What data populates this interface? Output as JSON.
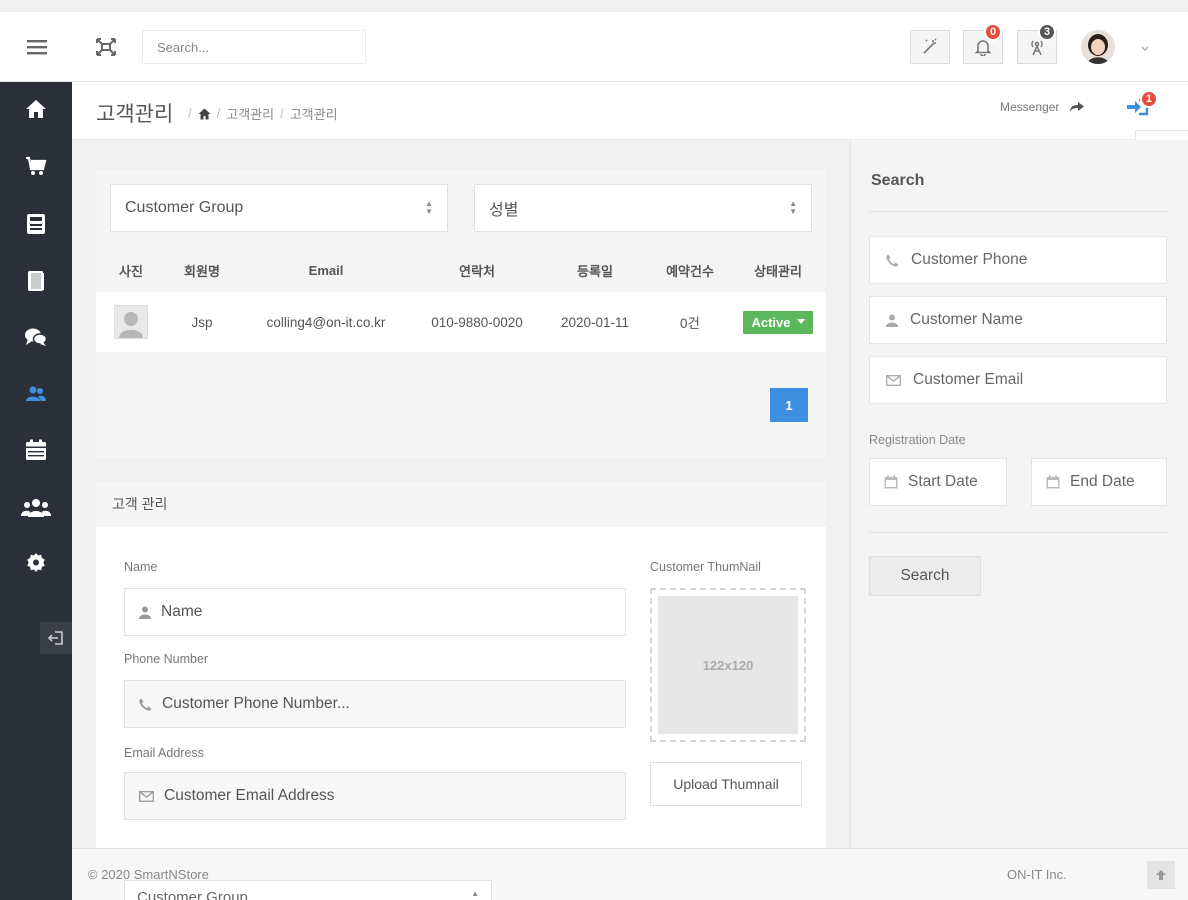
{
  "header": {
    "search_placeholder": "Search...",
    "notification_count": "0",
    "tasks_count": "3"
  },
  "page": {
    "title": "고객관리",
    "breadcrumb": [
      "고객관리",
      "고객관리"
    ],
    "messenger_label": "Messenger",
    "login_badge": "1"
  },
  "filters": {
    "group_select": "Customer Group",
    "gender_select": "성별"
  },
  "table": {
    "columns": [
      "사진",
      "회원명",
      "Email",
      "연락처",
      "등록일",
      "예약건수",
      "상태관리"
    ],
    "rows": [
      {
        "name": "Jsp",
        "email": "colling4@on-it.co.kr",
        "phone": "010-9880-0020",
        "date": "2020-01-11",
        "reservations": "0건",
        "status": "Active"
      }
    ],
    "page": "1"
  },
  "form": {
    "section_title": "고객 관리",
    "name_label": "Name",
    "name_placeholder": "Name",
    "phone_label": "Phone Number",
    "phone_placeholder": "Customer Phone Number...",
    "email_label": "Email Address",
    "email_placeholder": "Customer Email Address",
    "thumb_label": "Customer ThumNail",
    "thumb_size": "122x120",
    "upload_label": "Upload Thumnail",
    "group_select": "Customer Group"
  },
  "search_panel": {
    "title": "Search",
    "phone_placeholder": "Customer Phone",
    "name_placeholder": "Customer Name",
    "email_placeholder": "Customer Email",
    "date_label": "Registration Date",
    "start_date": "Start Date",
    "end_date": "End Date",
    "search_button": "Search"
  },
  "footer": {
    "copyright": "© 2020 SmartNStore",
    "company": "ON-IT Inc."
  },
  "colors": {
    "sidebar_bg": "#2b3038",
    "sidebar_active": "#3d8fe0",
    "accent_blue": "#3d8fe0",
    "status_green": "#5cb85c",
    "badge_red": "#e74c3c",
    "badge_grey": "#555555"
  }
}
